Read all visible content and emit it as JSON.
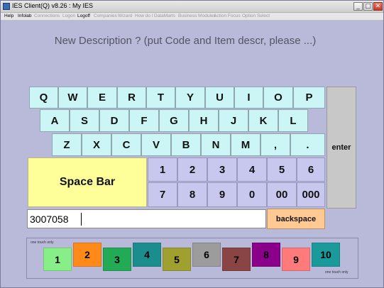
{
  "window": {
    "title": "IES Client(Q) v8.26 : My IES",
    "controls": {
      "minimize": "_",
      "maximize": "□",
      "close": "✕"
    }
  },
  "menu": [
    {
      "label": "Help",
      "enabled": true
    },
    {
      "label": "Infolab",
      "enabled": true
    },
    {
      "label": "Connections",
      "enabled": false
    },
    {
      "label": "Logon",
      "enabled": false
    },
    {
      "label": "Logoff",
      "enabled": true
    },
    {
      "label": "Companies",
      "enabled": false
    },
    {
      "label": "Wizard",
      "enabled": false
    },
    {
      "label": "How do I",
      "enabled": false
    },
    {
      "label": "DataMarts",
      "enabled": false
    },
    {
      "label": "Business Modules",
      "enabled": false
    },
    {
      "label": "Action Focus",
      "enabled": false
    },
    {
      "label": "Option Select",
      "enabled": false
    }
  ],
  "prompt": "New Description ? (put Code and Item descr, please ...)",
  "keyboard": {
    "row1": [
      "Q",
      "W",
      "E",
      "R",
      "T",
      "Y",
      "U",
      "I",
      "O",
      "P"
    ],
    "row2": [
      "A",
      "S",
      "D",
      "F",
      "G",
      "H",
      "J",
      "K",
      "L"
    ],
    "row3": [
      "Z",
      "X",
      "C",
      "V",
      "B",
      "N",
      "M",
      ",",
      "."
    ],
    "numbers_row1": [
      "1",
      "2",
      "3",
      "4",
      "5",
      "6"
    ],
    "numbers_row2": [
      "7",
      "8",
      "9",
      "0",
      "00",
      "000"
    ],
    "space_label": "Space Bar",
    "enter_label": "enter",
    "backspace_label": "backspace",
    "colors": {
      "letter": "#ccf6f6",
      "number": "#c8c8ee",
      "space": "#ffff99",
      "enter": "#c8c8c8",
      "backspace": "#ffc993"
    }
  },
  "input": {
    "value": "3007058"
  },
  "quick_panel": {
    "label_top": "one touch only",
    "label_bottom": "one touch only",
    "buttons": [
      {
        "label": "1",
        "color": "#88ee88"
      },
      {
        "label": "2",
        "color": "#ff8a1a"
      },
      {
        "label": "3",
        "color": "#22aa55"
      },
      {
        "label": "4",
        "color": "#1c8d8d"
      },
      {
        "label": "5",
        "color": "#a0a030"
      },
      {
        "label": "6",
        "color": "#9c9c9c"
      },
      {
        "label": "7",
        "color": "#8a4444"
      },
      {
        "label": "8",
        "color": "#8a008a"
      },
      {
        "label": "9",
        "color": "#ff7a7a"
      },
      {
        "label": "10",
        "color": "#1a9a9a"
      }
    ]
  }
}
